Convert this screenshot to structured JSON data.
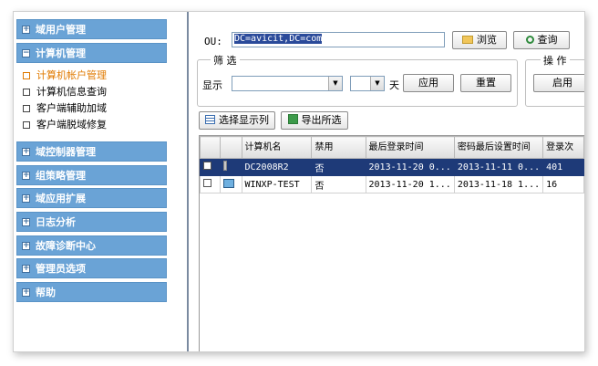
{
  "sidebar": {
    "sections": [
      {
        "label": "域用户管理"
      },
      {
        "label": "计算机管理"
      },
      {
        "label": "域控制器管理"
      },
      {
        "label": "组策略管理"
      },
      {
        "label": "域应用扩展"
      },
      {
        "label": "日志分析"
      },
      {
        "label": "故障诊断中心"
      },
      {
        "label": "管理员选项"
      },
      {
        "label": "帮助"
      }
    ],
    "computer_subitems": [
      {
        "label": "计算机帐户管理"
      },
      {
        "label": "计算机信息查询"
      },
      {
        "label": "客户端辅助加域"
      },
      {
        "label": "客户端脱域修复"
      }
    ]
  },
  "toolbar": {
    "ou_label": "OU:",
    "ou_value": "DC=avicit,DC=com",
    "browse_label": "浏览",
    "query_label": "查询"
  },
  "filter": {
    "legend": "筛 选",
    "show_label": "显示",
    "days_label": "天",
    "apply_label": "应用",
    "reset_label": "重置"
  },
  "operations": {
    "legend": "操 作",
    "enable_label": "启用"
  },
  "actions": {
    "select_columns_label": "选择显示列",
    "export_label": "导出所选"
  },
  "table": {
    "headers": [
      "",
      "",
      "计算机名",
      "禁用",
      "最后登录时间",
      "密码最后设置时间",
      "登录次"
    ],
    "rows": [
      {
        "name": "DC2008R2",
        "disabled": "否",
        "last_login": "2013-11-20 0...",
        "pwd_set": "2013-11-11 0...",
        "logins": "401"
      },
      {
        "name": "WINXP-TEST",
        "disabled": "否",
        "last_login": "2013-11-20 1...",
        "pwd_set": "2013-11-18 1...",
        "logins": "16"
      }
    ]
  }
}
